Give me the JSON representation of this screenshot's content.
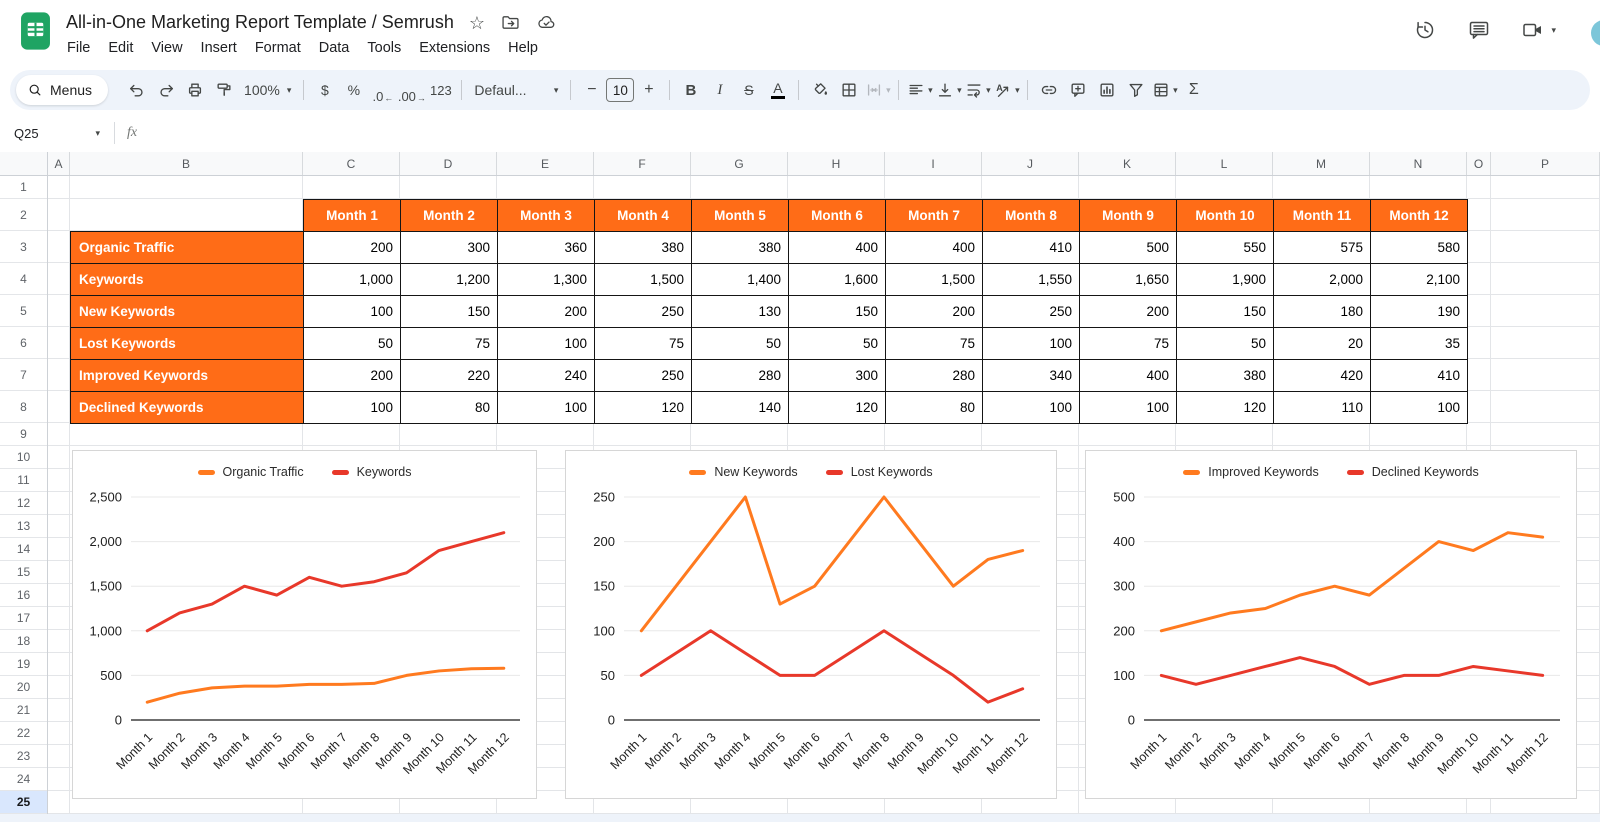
{
  "header": {
    "title": "All-in-One Marketing Report Template / Semrush",
    "menu_items": [
      "File",
      "Edit",
      "View",
      "Insert",
      "Format",
      "Data",
      "Tools",
      "Extensions",
      "Help"
    ]
  },
  "icons": {
    "star": "☆",
    "dropdown_caret": "▾",
    "decrease_decimal_arrow": "←",
    "increase_decimal_arrow": "→"
  },
  "toolbar": {
    "menus_label": "Menus",
    "zoom_value": "100%",
    "currency": "$",
    "percent": "%",
    "decrease_decimal": ".0",
    "increase_decimal": ".00",
    "plain_number": "123",
    "font_name": "Defaul...",
    "font_size": "10",
    "minus": "−",
    "plus": "+",
    "bold": "B",
    "italic": "I",
    "strikethrough": "S",
    "text_color": "A",
    "functions_sigma": "Σ"
  },
  "formula_bar": {
    "name_box": "Q25",
    "fx_label": "fx"
  },
  "grid": {
    "column_letters": [
      "A",
      "B",
      "C",
      "D",
      "E",
      "F",
      "G",
      "H",
      "I",
      "J",
      "K",
      "L",
      "M",
      "N",
      "O",
      "P"
    ],
    "visible_rows": 25,
    "selected_cell": "Q25",
    "selected_row": 25
  },
  "table": {
    "header_row": [
      "Month 1",
      "Month 2",
      "Month 3",
      "Month 4",
      "Month 5",
      "Month 6",
      "Month 7",
      "Month 8",
      "Month 9",
      "Month 10",
      "Month 11",
      "Month 12"
    ],
    "rows": [
      {
        "label": "Organic Traffic",
        "values": [
          "200",
          "300",
          "360",
          "380",
          "380",
          "400",
          "400",
          "410",
          "500",
          "550",
          "575",
          "580"
        ]
      },
      {
        "label": "Keywords",
        "values": [
          "1,000",
          "1,200",
          "1,300",
          "1,500",
          "1,400",
          "1,600",
          "1,500",
          "1,550",
          "1,650",
          "1,900",
          "2,000",
          "2,100"
        ]
      },
      {
        "label": "New Keywords",
        "values": [
          "100",
          "150",
          "200",
          "250",
          "130",
          "150",
          "200",
          "250",
          "200",
          "150",
          "180",
          "190"
        ]
      },
      {
        "label": "Lost Keywords",
        "values": [
          "50",
          "75",
          "100",
          "75",
          "50",
          "50",
          "75",
          "100",
          "75",
          "50",
          "20",
          "35"
        ]
      },
      {
        "label": "Improved Keywords",
        "values": [
          "200",
          "220",
          "240",
          "250",
          "280",
          "300",
          "280",
          "340",
          "400",
          "380",
          "420",
          "410"
        ]
      },
      {
        "label": "Declined Keywords",
        "values": [
          "100",
          "80",
          "100",
          "120",
          "140",
          "120",
          "80",
          "100",
          "100",
          "120",
          "110",
          "100"
        ]
      }
    ]
  },
  "colors": {
    "table_orange": "#ff6c17",
    "chart_orange": "#ff7a1f",
    "chart_red": "#e8382a",
    "selection_blue": "#d9e7fd",
    "logo_green": "#1fa463"
  },
  "chart_data": [
    {
      "type": "line",
      "categories": [
        "Month 1",
        "Month 2",
        "Month 3",
        "Month 4",
        "Month 5",
        "Month 6",
        "Month 7",
        "Month 8",
        "Month 9",
        "Month 10",
        "Month 11",
        "Month 12"
      ],
      "yticks": [
        0,
        500,
        1000,
        1500,
        2000,
        2500
      ],
      "ytick_labels": [
        "0",
        "500",
        "1,000",
        "1,500",
        "2,000",
        "2,500"
      ],
      "ymax": 2500,
      "legend_position": "top",
      "grid": true,
      "series": [
        {
          "name": "Organic Traffic",
          "color": "#ff7a1f",
          "values": [
            200,
            300,
            360,
            380,
            380,
            400,
            400,
            410,
            500,
            550,
            575,
            580
          ]
        },
        {
          "name": "Keywords",
          "color": "#e8382a",
          "values": [
            1000,
            1200,
            1300,
            1500,
            1400,
            1600,
            1500,
            1550,
            1650,
            1900,
            2000,
            2100
          ]
        }
      ]
    },
    {
      "type": "line",
      "categories": [
        "Month 1",
        "Month 2",
        "Month 3",
        "Month 4",
        "Month 5",
        "Month 6",
        "Month 7",
        "Month 8",
        "Month 9",
        "Month 10",
        "Month 11",
        "Month 12"
      ],
      "yticks": [
        0,
        50,
        100,
        150,
        200,
        250
      ],
      "ytick_labels": [
        "0",
        "50",
        "100",
        "150",
        "200",
        "250"
      ],
      "ymax": 250,
      "legend_position": "top",
      "grid": true,
      "series": [
        {
          "name": "New Keywords",
          "color": "#ff7a1f",
          "values": [
            100,
            150,
            200,
            250,
            130,
            150,
            200,
            250,
            200,
            150,
            180,
            190
          ]
        },
        {
          "name": "Lost Keywords",
          "color": "#e8382a",
          "values": [
            50,
            75,
            100,
            75,
            50,
            50,
            75,
            100,
            75,
            50,
            20,
            35
          ]
        }
      ]
    },
    {
      "type": "line",
      "categories": [
        "Month 1",
        "Month 2",
        "Month 3",
        "Month 4",
        "Month 5",
        "Month 6",
        "Month 7",
        "Month 8",
        "Month 9",
        "Month 10",
        "Month 11",
        "Month 12"
      ],
      "yticks": [
        0,
        100,
        200,
        300,
        400,
        500
      ],
      "ytick_labels": [
        "0",
        "100",
        "200",
        "300",
        "400",
        "500"
      ],
      "ymax": 500,
      "legend_position": "top",
      "grid": true,
      "series": [
        {
          "name": "Improved Keywords",
          "color": "#ff7a1f",
          "values": [
            200,
            220,
            240,
            250,
            280,
            300,
            280,
            340,
            400,
            380,
            420,
            410
          ]
        },
        {
          "name": "Declined Keywords",
          "color": "#e8382a",
          "values": [
            100,
            80,
            100,
            120,
            140,
            120,
            80,
            100,
            100,
            120,
            110,
            100
          ]
        }
      ]
    }
  ]
}
